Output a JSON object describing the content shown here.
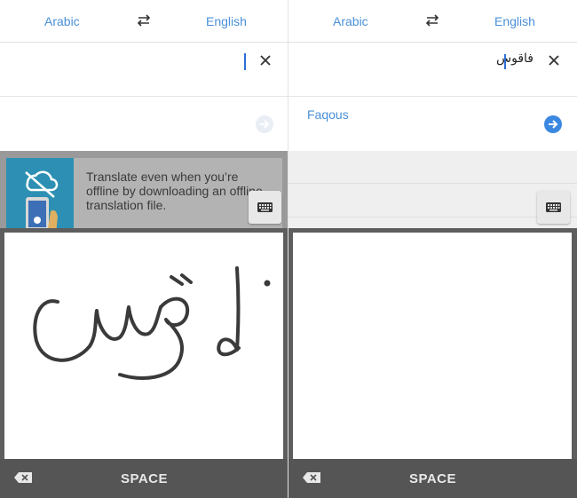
{
  "left_panel": {
    "source_lang": "Arabic",
    "target_lang": "English",
    "offline_card_text": "Translate even when you’re offline by downloading an offline translation file.",
    "space_label": "SPACE"
  },
  "right_panel": {
    "source_lang": "Arabic",
    "target_lang": "English",
    "input_text": "فاقوس",
    "translation": "Faqous",
    "space_label": "SPACE"
  },
  "handwriting_text": "فاقوس",
  "colors": {
    "link_blue": "#4a90d9",
    "accent_blue": "#3b88e0",
    "keyboard_bar": "#555555"
  },
  "icons": {
    "swap": "swap-arrows-icon",
    "clear": "close-icon",
    "go": "arrow-right-circle-icon",
    "keyboard": "keyboard-icon",
    "backspace": "backspace-icon"
  }
}
